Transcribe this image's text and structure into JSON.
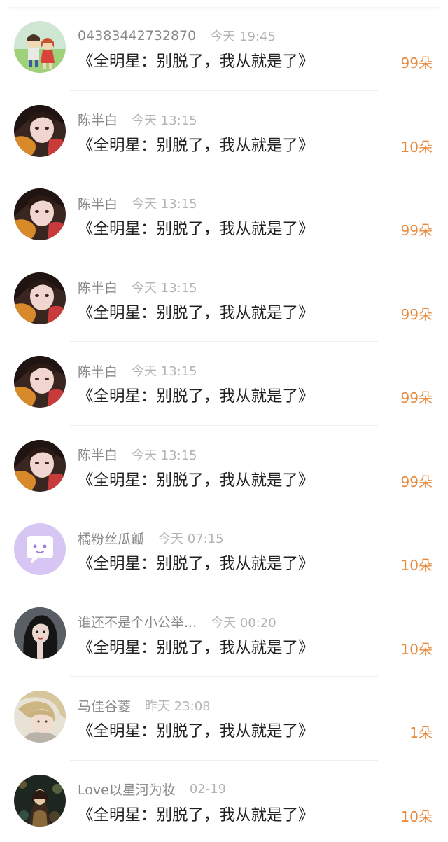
{
  "colors": {
    "accent": "#e78a3e",
    "username": "#888888",
    "timestamp": "#b4b4b4",
    "message": "#222222"
  },
  "items": [
    {
      "username": "04383442732870",
      "time": "今天 19:45",
      "message": "《全明星：别脱了，我从就是了》",
      "count": "99朵",
      "avatar": "cartoon-kids-avatar"
    },
    {
      "username": "陈半白",
      "time": "今天 13:15",
      "message": "《全明星：别脱了，我从就是了》",
      "count": "10朵",
      "avatar": "girl-photo-avatar"
    },
    {
      "username": "陈半白",
      "time": "今天 13:15",
      "message": "《全明星：别脱了，我从就是了》",
      "count": "99朵",
      "avatar": "girl-photo-avatar"
    },
    {
      "username": "陈半白",
      "time": "今天 13:15",
      "message": "《全明星：别脱了，我从就是了》",
      "count": "99朵",
      "avatar": "girl-photo-avatar"
    },
    {
      "username": "陈半白",
      "time": "今天 13:15",
      "message": "《全明星：别脱了，我从就是了》",
      "count": "99朵",
      "avatar": "girl-photo-avatar"
    },
    {
      "username": "陈半白",
      "time": "今天 13:15",
      "message": "《全明星：别脱了，我从就是了》",
      "count": "99朵",
      "avatar": "girl-photo-avatar"
    },
    {
      "username": "橘粉丝瓜瓤",
      "time": "今天 07:15",
      "message": "《全明星：别脱了，我从就是了》",
      "count": "10朵",
      "avatar": "chat-bubble-avatar"
    },
    {
      "username": "谁还不是个小公举...",
      "time": "今天 00:20",
      "message": "《全明星：别脱了，我从就是了》",
      "count": "10朵",
      "avatar": "illustrated-woman-avatar"
    },
    {
      "username": "马佳谷菱",
      "time": "昨天 23:08",
      "message": "《全明星：别脱了，我从就是了》",
      "count": "1朵",
      "avatar": "blonde-man-avatar"
    },
    {
      "username": "Love以星河为妆",
      "time": "02-19",
      "message": "《全明星：别脱了，我从就是了》",
      "count": "10朵",
      "avatar": "fantasy-art-avatar"
    }
  ]
}
